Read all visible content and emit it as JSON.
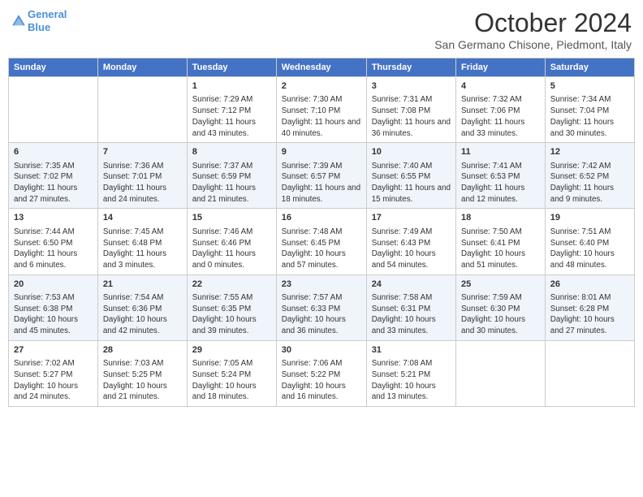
{
  "header": {
    "logo_line1": "General",
    "logo_line2": "Blue",
    "month": "October 2024",
    "location": "San Germano Chisone, Piedmont, Italy"
  },
  "days_of_week": [
    "Sunday",
    "Monday",
    "Tuesday",
    "Wednesday",
    "Thursday",
    "Friday",
    "Saturday"
  ],
  "weeks": [
    [
      {
        "day": "",
        "info": ""
      },
      {
        "day": "",
        "info": ""
      },
      {
        "day": "1",
        "info": "Sunrise: 7:29 AM\nSunset: 7:12 PM\nDaylight: 11 hours and 43 minutes."
      },
      {
        "day": "2",
        "info": "Sunrise: 7:30 AM\nSunset: 7:10 PM\nDaylight: 11 hours and 40 minutes."
      },
      {
        "day": "3",
        "info": "Sunrise: 7:31 AM\nSunset: 7:08 PM\nDaylight: 11 hours and 36 minutes."
      },
      {
        "day": "4",
        "info": "Sunrise: 7:32 AM\nSunset: 7:06 PM\nDaylight: 11 hours and 33 minutes."
      },
      {
        "day": "5",
        "info": "Sunrise: 7:34 AM\nSunset: 7:04 PM\nDaylight: 11 hours and 30 minutes."
      }
    ],
    [
      {
        "day": "6",
        "info": "Sunrise: 7:35 AM\nSunset: 7:02 PM\nDaylight: 11 hours and 27 minutes."
      },
      {
        "day": "7",
        "info": "Sunrise: 7:36 AM\nSunset: 7:01 PM\nDaylight: 11 hours and 24 minutes."
      },
      {
        "day": "8",
        "info": "Sunrise: 7:37 AM\nSunset: 6:59 PM\nDaylight: 11 hours and 21 minutes."
      },
      {
        "day": "9",
        "info": "Sunrise: 7:39 AM\nSunset: 6:57 PM\nDaylight: 11 hours and 18 minutes."
      },
      {
        "day": "10",
        "info": "Sunrise: 7:40 AM\nSunset: 6:55 PM\nDaylight: 11 hours and 15 minutes."
      },
      {
        "day": "11",
        "info": "Sunrise: 7:41 AM\nSunset: 6:53 PM\nDaylight: 11 hours and 12 minutes."
      },
      {
        "day": "12",
        "info": "Sunrise: 7:42 AM\nSunset: 6:52 PM\nDaylight: 11 hours and 9 minutes."
      }
    ],
    [
      {
        "day": "13",
        "info": "Sunrise: 7:44 AM\nSunset: 6:50 PM\nDaylight: 11 hours and 6 minutes."
      },
      {
        "day": "14",
        "info": "Sunrise: 7:45 AM\nSunset: 6:48 PM\nDaylight: 11 hours and 3 minutes."
      },
      {
        "day": "15",
        "info": "Sunrise: 7:46 AM\nSunset: 6:46 PM\nDaylight: 11 hours and 0 minutes."
      },
      {
        "day": "16",
        "info": "Sunrise: 7:48 AM\nSunset: 6:45 PM\nDaylight: 10 hours and 57 minutes."
      },
      {
        "day": "17",
        "info": "Sunrise: 7:49 AM\nSunset: 6:43 PM\nDaylight: 10 hours and 54 minutes."
      },
      {
        "day": "18",
        "info": "Sunrise: 7:50 AM\nSunset: 6:41 PM\nDaylight: 10 hours and 51 minutes."
      },
      {
        "day": "19",
        "info": "Sunrise: 7:51 AM\nSunset: 6:40 PM\nDaylight: 10 hours and 48 minutes."
      }
    ],
    [
      {
        "day": "20",
        "info": "Sunrise: 7:53 AM\nSunset: 6:38 PM\nDaylight: 10 hours and 45 minutes."
      },
      {
        "day": "21",
        "info": "Sunrise: 7:54 AM\nSunset: 6:36 PM\nDaylight: 10 hours and 42 minutes."
      },
      {
        "day": "22",
        "info": "Sunrise: 7:55 AM\nSunset: 6:35 PM\nDaylight: 10 hours and 39 minutes."
      },
      {
        "day": "23",
        "info": "Sunrise: 7:57 AM\nSunset: 6:33 PM\nDaylight: 10 hours and 36 minutes."
      },
      {
        "day": "24",
        "info": "Sunrise: 7:58 AM\nSunset: 6:31 PM\nDaylight: 10 hours and 33 minutes."
      },
      {
        "day": "25",
        "info": "Sunrise: 7:59 AM\nSunset: 6:30 PM\nDaylight: 10 hours and 30 minutes."
      },
      {
        "day": "26",
        "info": "Sunrise: 8:01 AM\nSunset: 6:28 PM\nDaylight: 10 hours and 27 minutes."
      }
    ],
    [
      {
        "day": "27",
        "info": "Sunrise: 7:02 AM\nSunset: 5:27 PM\nDaylight: 10 hours and 24 minutes."
      },
      {
        "day": "28",
        "info": "Sunrise: 7:03 AM\nSunset: 5:25 PM\nDaylight: 10 hours and 21 minutes."
      },
      {
        "day": "29",
        "info": "Sunrise: 7:05 AM\nSunset: 5:24 PM\nDaylight: 10 hours and 18 minutes."
      },
      {
        "day": "30",
        "info": "Sunrise: 7:06 AM\nSunset: 5:22 PM\nDaylight: 10 hours and 16 minutes."
      },
      {
        "day": "31",
        "info": "Sunrise: 7:08 AM\nSunset: 5:21 PM\nDaylight: 10 hours and 13 minutes."
      },
      {
        "day": "",
        "info": ""
      },
      {
        "day": "",
        "info": ""
      }
    ]
  ]
}
